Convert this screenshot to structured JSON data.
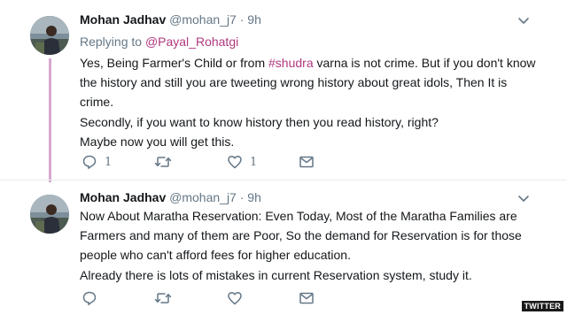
{
  "tweets": [
    {
      "author_name": "Mohan Jadhav",
      "handle": "@mohan_j7",
      "separator": "·",
      "time": "9h",
      "replying_prefix": "Replying to",
      "replying_to": "@Payal_Rohatgi",
      "body": {
        "p1_before_hashtag": "Yes, Being Farmer's Child or from",
        "hashtag": "#shudra",
        "p1_after_hashtag": "varna is not crime. But if you don't know the history and still you are tweeting wrong history about great idols, Then It is crime.",
        "p2": "Secondly, if you want to know history then you read history, right?",
        "p3": "Maybe now you will get this."
      },
      "actions": {
        "reply_count": "1",
        "retweet_count": "",
        "like_count": "1"
      }
    },
    {
      "author_name": "Mohan Jadhav",
      "handle": "@mohan_j7",
      "separator": "·",
      "time": "9h",
      "body": {
        "p1": "Now About Maratha Reservation: Even Today, Most of the Maratha Families are Farmers and many of them are Poor, So the demand for Reservation is for those people who can't afford fees for higher education.",
        "p2": "Already there is lots of mistakes in current Reservation system, study it."
      },
      "actions": {
        "reply_count": "",
        "retweet_count": "",
        "like_count": ""
      }
    }
  ],
  "icons": {
    "reply": "reply-icon",
    "retweet": "retweet-icon",
    "like": "heart-icon",
    "message": "direct-message-icon",
    "menu": "chevron-down-icon"
  },
  "colors": {
    "mention": "#b0397f",
    "thread_line": "#d6a9cf",
    "secondary_text": "#657786"
  },
  "watermark": "TWITTER"
}
